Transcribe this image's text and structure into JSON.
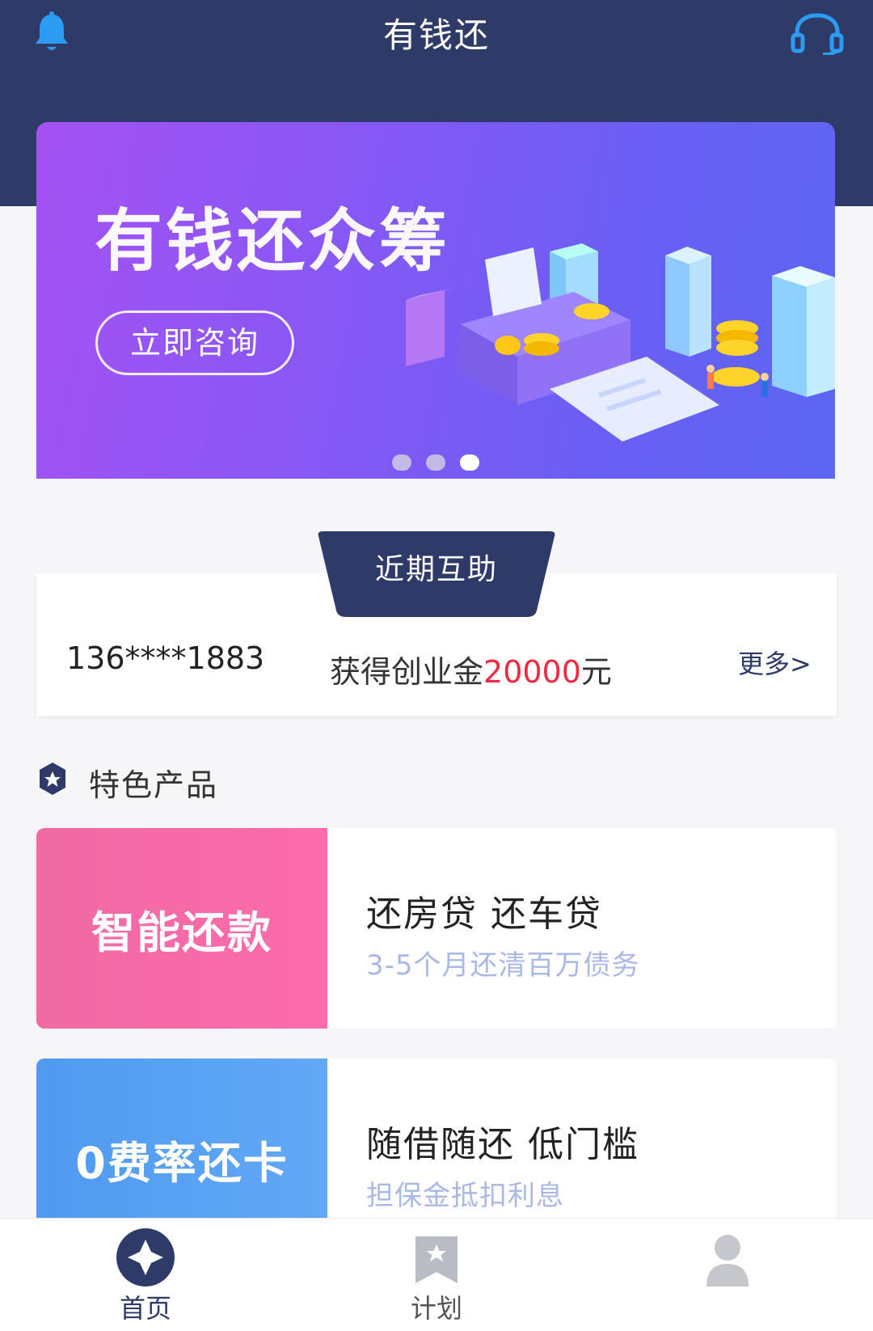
{
  "header": {
    "title": "有钱还",
    "left_icon": "bell-icon",
    "right_icon": "headset-icon"
  },
  "banner": {
    "title": "有钱还众筹",
    "button_label": "立即咨询",
    "slides_total": 3,
    "active_slide": 3
  },
  "feed": {
    "tab_label": "近期互助",
    "phone": "136****1883",
    "text_prefix": "获得创业金",
    "amount": "20000",
    "text_suffix": "元",
    "more_label": "更多>"
  },
  "section": {
    "title": "特色产品",
    "icon": "star-badge-icon"
  },
  "products": [
    {
      "tag": "智能还款",
      "headline": "还房贷 还车贷",
      "subtitle": "3-5个月还清百万债务"
    },
    {
      "tag": "0费率还卡",
      "headline": "随借随还 低门槛",
      "subtitle": "担保金抵扣利息"
    }
  ],
  "tabbar": {
    "items": [
      {
        "label": "首页",
        "icon": "diamond-icon",
        "active": true
      },
      {
        "label": "计划",
        "icon": "bookmark-star-icon",
        "active": false
      },
      {
        "label": "",
        "icon": "user-icon",
        "active": false
      }
    ]
  },
  "colors": {
    "header_bg": "#2e3a68",
    "amount_red": "#f0293f",
    "subtitle_blue": "#a9b8e6",
    "pink": "#fd6bad",
    "blue": "#5aa4f3"
  }
}
